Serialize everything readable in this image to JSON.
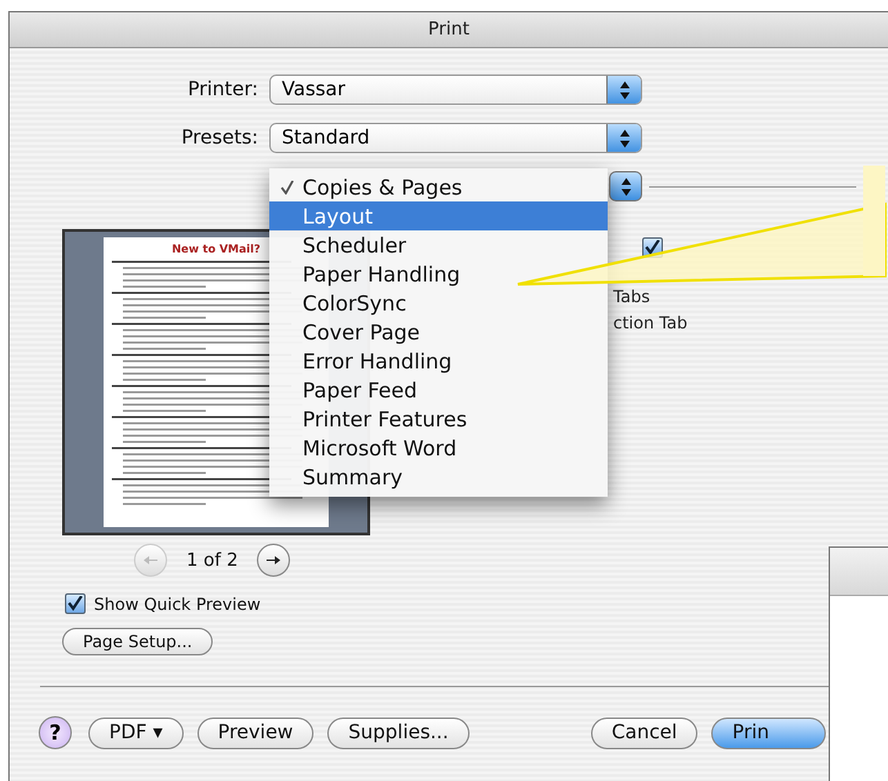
{
  "window": {
    "title": "Print"
  },
  "printer": {
    "label": "Printer:",
    "value": "Vassar"
  },
  "presets": {
    "label": "Presets:",
    "value": "Standard"
  },
  "panel_menu": {
    "items": [
      {
        "label": "Copies & Pages",
        "checked": true,
        "selected": false
      },
      {
        "label": "Layout",
        "checked": false,
        "selected": true
      },
      {
        "label": "Scheduler",
        "checked": false,
        "selected": false
      },
      {
        "label": "Paper Handling",
        "checked": false,
        "selected": false
      },
      {
        "label": "ColorSync",
        "checked": false,
        "selected": false
      },
      {
        "label": "Cover Page",
        "checked": false,
        "selected": false
      },
      {
        "label": "Error Handling",
        "checked": false,
        "selected": false
      },
      {
        "label": "Paper Feed",
        "checked": false,
        "selected": false
      },
      {
        "label": "Printer Features",
        "checked": false,
        "selected": false
      },
      {
        "label": "Microsoft Word",
        "checked": false,
        "selected": false
      },
      {
        "label": "Summary",
        "checked": false,
        "selected": false
      }
    ]
  },
  "options_behind_menu": {
    "checkbox_checked": true,
    "texts": [
      "Tabs",
      "ction Tab"
    ]
  },
  "preview": {
    "document_title": "New to VMail?"
  },
  "pager": {
    "text": "1 of 2",
    "prev_disabled": true,
    "next_disabled": false
  },
  "show_quick_preview": {
    "label": "Show Quick Preview",
    "checked": true
  },
  "page_setup_button": "Page Setup...",
  "footer": {
    "help": "?",
    "left_buttons": [
      {
        "label": "PDF ▾"
      },
      {
        "label": "Preview"
      },
      {
        "label": "Supplies..."
      }
    ],
    "right_buttons": [
      {
        "label": "Cancel",
        "default": false
      },
      {
        "label": "Prin",
        "default": true
      }
    ]
  }
}
